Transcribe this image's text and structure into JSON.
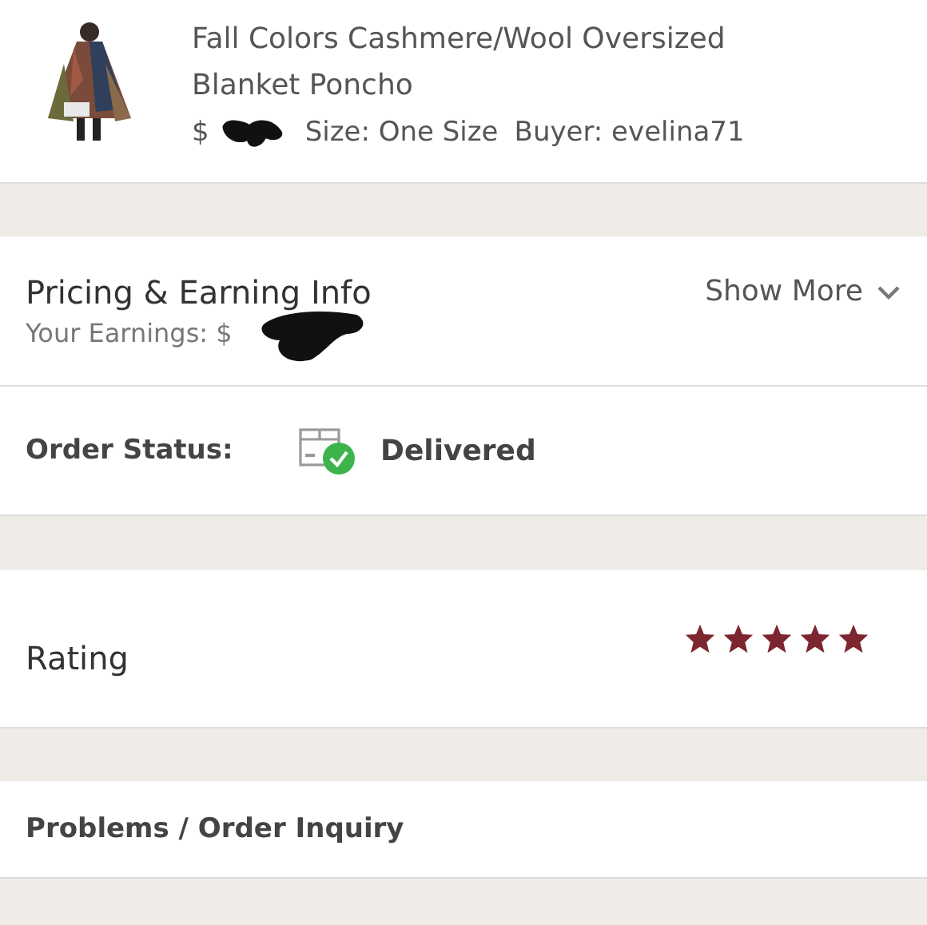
{
  "item": {
    "title": "Fall Colors Cashmere/Wool Oversized Blanket Poncho",
    "price": "$",
    "size": "Size: One Size",
    "buyer": "Buyer: evelina71"
  },
  "pricing": {
    "title": "Pricing & Earning Info",
    "earnings": "Your Earnings: $",
    "toggle": "Show More",
    "expanded": false
  },
  "order_status": {
    "label": "Order Status:",
    "value": "Delivered",
    "delivered": true
  },
  "rating": {
    "label": "Rating",
    "stars": 5
  },
  "problems": {
    "label": "Problems / Order Inquiry"
  }
}
